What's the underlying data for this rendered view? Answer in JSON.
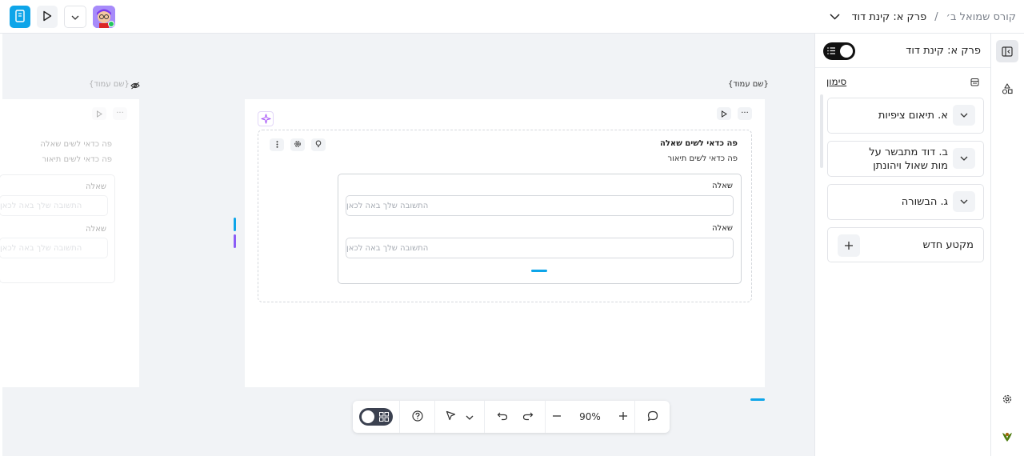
{
  "topbar": {
    "breadcrumb_root": "קורס שמואל ב׳",
    "breadcrumb_sep": "/",
    "breadcrumb_current": "פרק א: קינת דוד"
  },
  "canvas": {
    "page_main_label": "{שם עמוד}",
    "page_ghost_label": "{שם עמוד}",
    "question": {
      "title": "פה כדאי לשים שאלה",
      "description": "פה כדאי לשים תיאור",
      "items": [
        {
          "label": "שאלה",
          "placeholder": "התשובה שלך באה לכאן"
        },
        {
          "label": "שאלה",
          "placeholder": "התשובה שלך באה לכאן"
        }
      ]
    }
  },
  "toolbar": {
    "zoom": "90%"
  },
  "sidebar": {
    "title": "פרק א: קינת דוד",
    "link": "סימון",
    "sections": [
      {
        "label": "א. תיאום ציפיות"
      },
      {
        "label": "ב. דוד מתבשר על מות שאול ויהונתן"
      },
      {
        "label": "ג. הבשורה"
      }
    ],
    "new_section": "מקטע חדש"
  },
  "colors": {
    "primary": "#0ea5e9",
    "accent_purple": "#8b5cf6",
    "online": "#22c55e"
  }
}
